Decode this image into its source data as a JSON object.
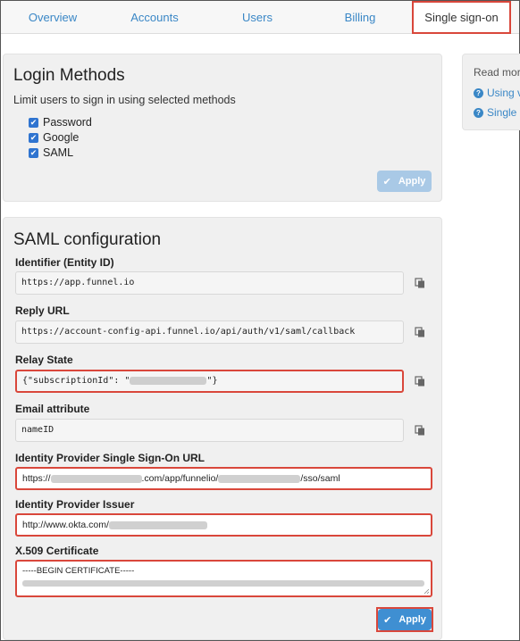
{
  "tabs": [
    {
      "label": "Overview"
    },
    {
      "label": "Accounts"
    },
    {
      "label": "Users"
    },
    {
      "label": "Billing"
    },
    {
      "label": "Single sign-on",
      "active": true
    }
  ],
  "login_methods": {
    "title": "Login Methods",
    "subtitle": "Limit users to sign in using selected methods",
    "options": [
      {
        "label": "Password",
        "checked": true
      },
      {
        "label": "Google",
        "checked": true
      },
      {
        "label": "SAML",
        "checked": true
      }
    ],
    "apply_label": "Apply"
  },
  "saml": {
    "title": "SAML configuration",
    "fields": {
      "entity_id": {
        "label": "Identifier (Entity ID)",
        "value": "https://app.funnel.io"
      },
      "reply_url": {
        "label": "Reply URL",
        "value": "https://account-config-api.funnel.io/api/auth/v1/saml/callback"
      },
      "relay_state": {
        "label": "Relay State",
        "value_prefix": "{\"subscriptionId\": \"",
        "value_suffix": "\"}"
      },
      "email_attribute": {
        "label": "Email attribute",
        "value": "nameID"
      },
      "idp_sso_url": {
        "label": "Identity Provider Single Sign-On URL",
        "value_prefix": "https://",
        "value_middle": ".com/app/funnelio/",
        "value_suffix": "/sso/saml"
      },
      "idp_issuer": {
        "label": "Identity Provider Issuer",
        "value_prefix": "http://www.okta.com/"
      },
      "certificate": {
        "label": "X.509 Certificate",
        "value": "-----BEGIN CERTIFICATE-----"
      }
    },
    "apply_label": "Apply"
  },
  "side": {
    "heading": "Read more",
    "links": [
      "Using v",
      "Single s"
    ]
  },
  "colors": {
    "link": "#3a87c6",
    "highlight": "#d9473b",
    "button": "#3f8fd2",
    "button_disabled": "#a9c9e6"
  }
}
